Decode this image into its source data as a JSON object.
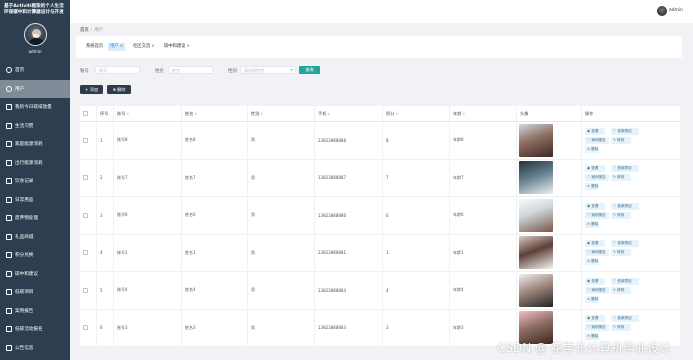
{
  "sidebar": {
    "title": "基于Activiti框架的个人生活环保碳中和计算器设计与开发",
    "avatar_text": "嗨拍",
    "username": "admin",
    "items": [
      {
        "label": "首页",
        "icon": "home-icon"
      },
      {
        "label": "用户",
        "icon": "user-icon"
      },
      {
        "label": "我的今日碳排放量",
        "icon": "doc-icon"
      },
      {
        "label": "生活习惯",
        "icon": "doc-icon"
      },
      {
        "label": "家庭能源消耗",
        "icon": "doc-icon"
      },
      {
        "label": "出行能源消耗",
        "icon": "doc-icon"
      },
      {
        "label": "饮食记录",
        "icon": "doc-icon"
      },
      {
        "label": "日常用品",
        "icon": "doc-icon"
      },
      {
        "label": "废弃物处理",
        "icon": "doc-icon"
      },
      {
        "label": "礼品商城",
        "icon": "gift-icon"
      },
      {
        "label": "积分兑换",
        "icon": "doc-icon"
      },
      {
        "label": "碳中和建议",
        "icon": "doc-icon"
      },
      {
        "label": "低碳项目",
        "icon": "doc-icon"
      },
      {
        "label": "案例报告",
        "icon": "doc-icon"
      },
      {
        "label": "低碳活动报名",
        "icon": "doc-icon"
      },
      {
        "label": "公告信息",
        "icon": "bell-icon"
      }
    ],
    "active_index": 1
  },
  "topbar": {
    "username": "admin"
  },
  "breadcrumb": {
    "home": "首页",
    "current": "用户"
  },
  "tabs": [
    {
      "label": "系统首页",
      "closable": false
    },
    {
      "label": "用户",
      "closable": true
    },
    {
      "label": "社区交流",
      "closable": true
    },
    {
      "label": "碳中和建议",
      "closable": true
    }
  ],
  "active_tab": 1,
  "search": {
    "account_label": "账号",
    "account_placeholder": "账号",
    "name_label": "姓名",
    "name_placeholder": "姓名",
    "gender_label": "性别",
    "gender_placeholder": "请选择性别",
    "search_button": "查询"
  },
  "actions": {
    "add": "+ 添加",
    "delete": "删除"
  },
  "table": {
    "columns": [
      "序号",
      "账号",
      "姓名",
      "性别",
      "手机",
      "积分",
      "年龄",
      "头像",
      "操作"
    ],
    "rows": [
      {
        "index": "1",
        "account": "账号8",
        "name": "姓名8",
        "gender": "男",
        "phone": "13823888888",
        "points": "8",
        "age": "年龄8"
      },
      {
        "index": "2",
        "account": "账号7",
        "name": "姓名7",
        "gender": "男",
        "phone": "13823888887",
        "points": "7",
        "age": "年龄7"
      },
      {
        "index": "3",
        "account": "账号6",
        "name": "姓名6",
        "gender": "男",
        "phone": "13823888886",
        "points": "6",
        "age": "年龄6"
      },
      {
        "index": "4",
        "account": "账号1",
        "name": "姓名1",
        "gender": "男",
        "phone": "13823888881",
        "points": "1",
        "age": "年龄1"
      },
      {
        "index": "5",
        "account": "账号4",
        "name": "姓名4",
        "gender": "男",
        "phone": "13823888884",
        "points": "4",
        "age": "年龄4"
      },
      {
        "index": "6",
        "account": "账号3",
        "name": "姓名3",
        "gender": "男",
        "phone": "13823888883",
        "points": "3",
        "age": "年龄3"
      }
    ],
    "ops": {
      "view": "查看",
      "project": "低碳项目",
      "report": "案例报告",
      "edit": "修改",
      "delete": "删除"
    }
  },
  "watermark": "CSDN @ 花学长计算机毕业设计"
}
